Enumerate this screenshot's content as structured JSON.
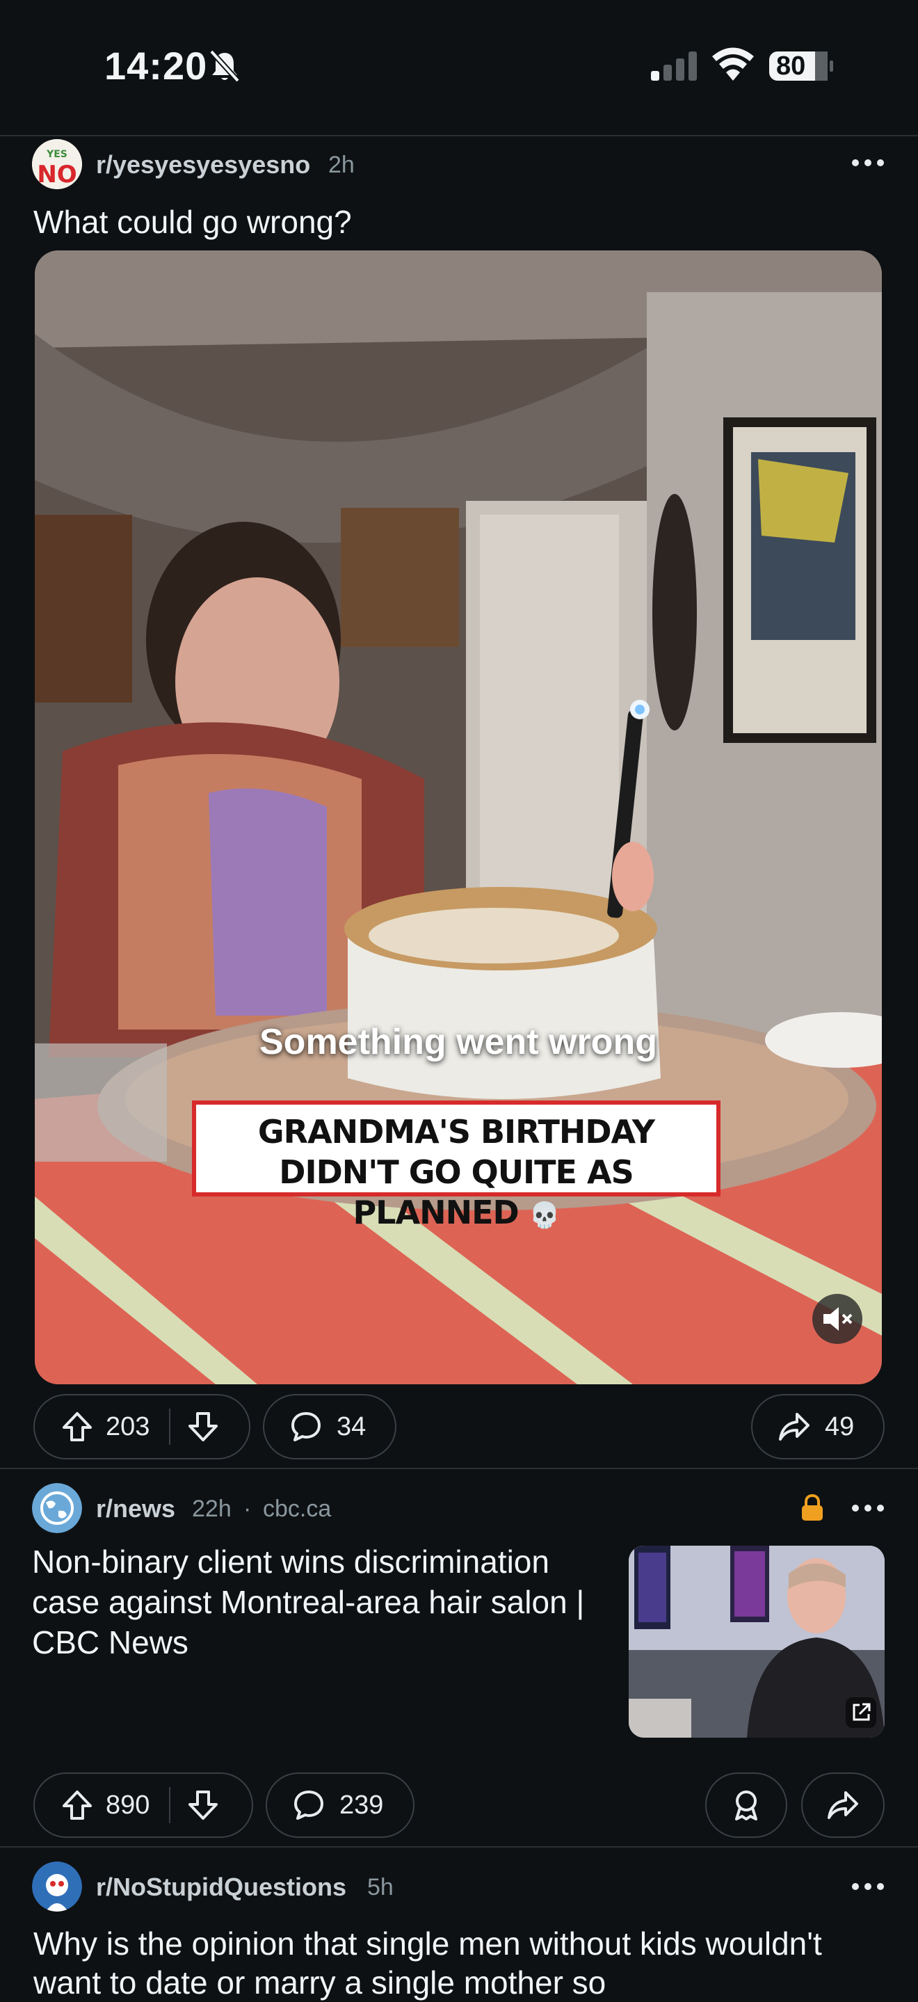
{
  "status_bar": {
    "time": "14:20",
    "battery": "80"
  },
  "posts": [
    {
      "subreddit": "r/yesyesyesyesno",
      "age": "2h",
      "avatar_text": "NO",
      "title": "What could go wrong?",
      "media": {
        "error_text": "Something went wrong",
        "caption_line1": "GRANDMA'S BIRTHDAY",
        "caption_line2": "DIDN'T GO QUITE AS PLANNED",
        "caption_emoji": "💀"
      },
      "upvotes": "203",
      "comments": "34",
      "shares": "49"
    },
    {
      "subreddit": "r/news",
      "age": "22h",
      "domain": "cbc.ca",
      "title": "Non-binary client wins discrimination case against Montreal-area hair salon | CBC News",
      "upvotes": "890",
      "comments": "239"
    },
    {
      "subreddit": "r/NoStupidQuestions",
      "age": "5h",
      "title": "Why is the opinion that single men without kids wouldn't want to date or marry a single mother so"
    }
  ],
  "colors": {
    "background": "#0e1113",
    "pill_border": "#3a4045",
    "lock": "#f0a020"
  },
  "icons": [
    "bell-off-icon",
    "signal-icon",
    "wifi-icon",
    "battery-icon",
    "more-icon",
    "upvote-icon",
    "downvote-icon",
    "comment-icon",
    "share-icon",
    "award-icon",
    "lock-icon",
    "mute-icon",
    "external-link-icon"
  ]
}
